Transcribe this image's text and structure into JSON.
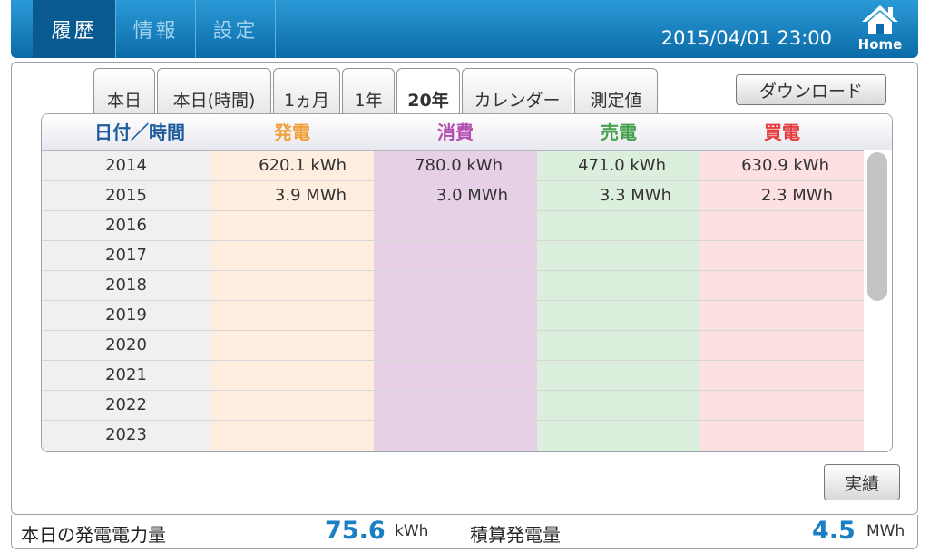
{
  "nav": {
    "tabs": [
      {
        "label": "履歴",
        "active": true
      },
      {
        "label": "情報",
        "active": false
      },
      {
        "label": "設定",
        "active": false
      }
    ],
    "datetime": "2015/04/01 23:00",
    "home_label": "Home"
  },
  "subtabs": [
    {
      "label": "本日",
      "active": false
    },
    {
      "label": "本日(時間)",
      "active": false
    },
    {
      "label": "1ヵ月",
      "active": false
    },
    {
      "label": "1年",
      "active": false
    },
    {
      "label": "20年",
      "active": true
    },
    {
      "label": "カレンダー",
      "active": false
    },
    {
      "label": "測定値",
      "active": false
    }
  ],
  "download_label": "ダウンロード",
  "table": {
    "headers": {
      "date": "日付／時間",
      "generation": "発電",
      "consumption": "消費",
      "sold": "売電",
      "bought": "買電"
    },
    "colors": {
      "date_header": "#1e5c9c",
      "generation": "#f2a03a",
      "consumption": "#b44db0",
      "sold": "#44a04a",
      "bought": "#e43c3c",
      "bg_date": "#f0f0f0",
      "bg_generation": "#fdeee0",
      "bg_consumption": "#e5d0e6",
      "bg_sold": "#dcefdc",
      "bg_bought": "#fde0e2"
    },
    "rows": [
      {
        "year": "2014",
        "generation": "620.1 kWh",
        "consumption": "780.0 kWh",
        "sold": "471.0 kWh",
        "bought": "630.9 kWh"
      },
      {
        "year": "2015",
        "generation": "3.9 MWh",
        "consumption": "3.0 MWh",
        "sold": "3.3 MWh",
        "bought": "2.3 MWh"
      },
      {
        "year": "2016",
        "generation": "",
        "consumption": "",
        "sold": "",
        "bought": ""
      },
      {
        "year": "2017",
        "generation": "",
        "consumption": "",
        "sold": "",
        "bought": ""
      },
      {
        "year": "2018",
        "generation": "",
        "consumption": "",
        "sold": "",
        "bought": ""
      },
      {
        "year": "2019",
        "generation": "",
        "consumption": "",
        "sold": "",
        "bought": ""
      },
      {
        "year": "2020",
        "generation": "",
        "consumption": "",
        "sold": "",
        "bought": ""
      },
      {
        "year": "2021",
        "generation": "",
        "consumption": "",
        "sold": "",
        "bought": ""
      },
      {
        "year": "2022",
        "generation": "",
        "consumption": "",
        "sold": "",
        "bought": ""
      },
      {
        "year": "2023",
        "generation": "",
        "consumption": "",
        "sold": "",
        "bought": ""
      }
    ]
  },
  "result_label": "実績",
  "footer": {
    "today_label": "本日の発電電力量",
    "today_value": "75.6",
    "today_unit": "kWh",
    "total_label": "積算発電量",
    "total_value": "4.5",
    "total_unit": "MWh"
  }
}
